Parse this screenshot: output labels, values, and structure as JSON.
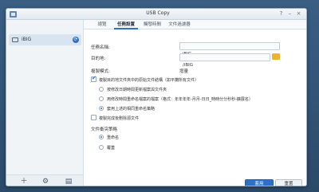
{
  "window": {
    "title": "USB Copy"
  },
  "sidebar": {
    "items": [
      {
        "label": "iBIG"
      }
    ]
  },
  "tabs": [
    {
      "label": "總覽"
    },
    {
      "label": "任務設置"
    },
    {
      "label": "觸發時間"
    },
    {
      "label": "文件過濾器"
    }
  ],
  "form": {
    "task_name_label": "任務名稱:",
    "task_name_value": "iBIG",
    "destination_label": "目的地:",
    "destination_value": "/iBIG",
    "copy_mode_label": "複製模式:",
    "copy_mode_value": "增量",
    "keep_structure_label": "複製目的地文件夾中的原始文件結構（如平攤所有文件）",
    "option_overwrite_label": "按修改日期時間更新檔案與文件夾",
    "option_rename_label": "用修改時間重命名檔案的檔案（格式：年年年年-月月-日日_時時分分秒秒-擴展名）",
    "option_keep_label": "套用上述的相同重命名策略",
    "delete_source_label": "複製完成後刪除源文件",
    "conflict_label": "文件衝突策略",
    "conflict_rename_label": "重命名",
    "conflict_overwrite_label": "覆蓋"
  },
  "buttons": {
    "apply": "套用",
    "reset": "重置"
  }
}
